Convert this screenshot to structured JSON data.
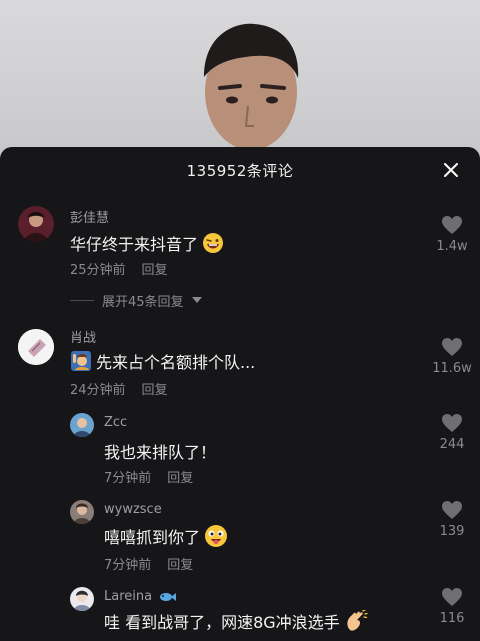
{
  "sheet": {
    "title": "135952条评论"
  },
  "comments": [
    {
      "username": "彭佳慧",
      "content": "华仔终于来抖音了",
      "time": "25分钟前",
      "reply_label": "回复",
      "likes": "1.4w",
      "expand_label": "展开45条回复"
    },
    {
      "username": "肖战",
      "content": "先来占个名额排个队...",
      "time": "24分钟前",
      "reply_label": "回复",
      "likes": "11.6w"
    }
  ],
  "replies": [
    {
      "username": "Zcc",
      "content": "我也来排队了！",
      "time": "7分钟前",
      "reply_label": "回复",
      "likes": "244"
    },
    {
      "username": "wywzsce",
      "content": "嘻嘻抓到你了",
      "time": "7分钟前",
      "reply_label": "回复",
      "likes": "139"
    },
    {
      "username": "Lareina",
      "content": "哇 看到战哥了，网速8G冲浪选手",
      "likes": "116"
    }
  ],
  "colors": {
    "sheet_bg": "#161618",
    "text_secondary": "#8a8a90",
    "username": "#9e9ea4"
  },
  "icons": {
    "close": "close-icon",
    "like": "heart-icon",
    "expand_arrow": "caret-down-icon"
  }
}
